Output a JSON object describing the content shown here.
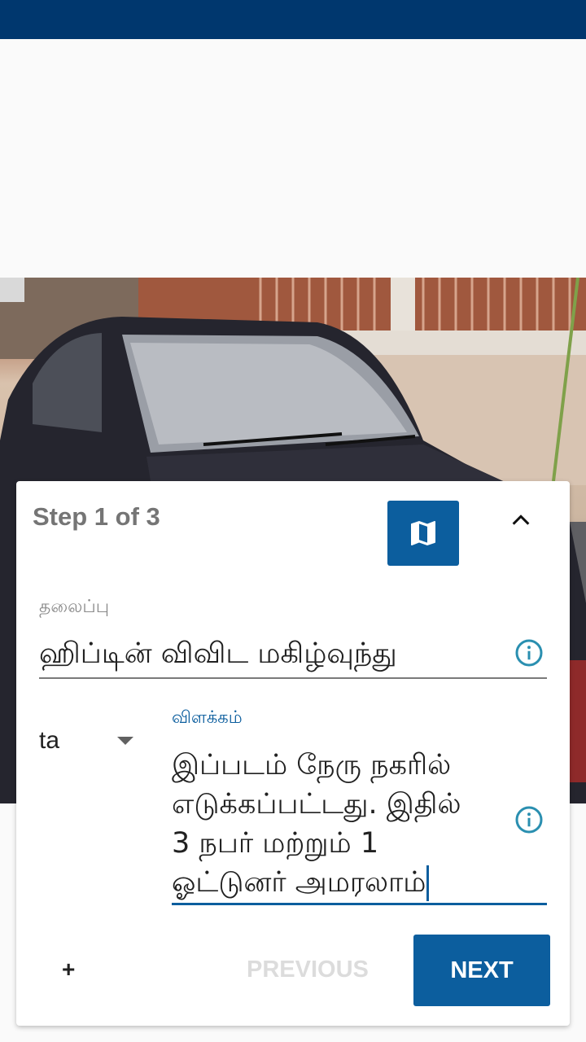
{
  "wizard": {
    "step_label": "Step 1 of 3",
    "map_icon": "map-icon",
    "collapse_icon": "chevron-up-icon"
  },
  "title_field": {
    "label": "தலைப்பு",
    "value": "ஹிப்டின் விவிட மகிழ்வுந்து",
    "info_icon": "info-icon"
  },
  "language": {
    "selected": "ta"
  },
  "description_field": {
    "label": "விளக்கம்",
    "value": "இப்படம் நேரு நகரில்\nஎடுக்கப்பட்டது. இதில்\n3 நபர் மற்றும் 1\nஓட்டுனர் அமரலாம்",
    "info_icon": "info-icon"
  },
  "actions": {
    "add_label": "+",
    "previous_label": "PREVIOUS",
    "next_label": "NEXT"
  },
  "colors": {
    "status_bar": "#00376e",
    "accent": "#0c5e9e",
    "info_icon": "#2a8fb0"
  }
}
